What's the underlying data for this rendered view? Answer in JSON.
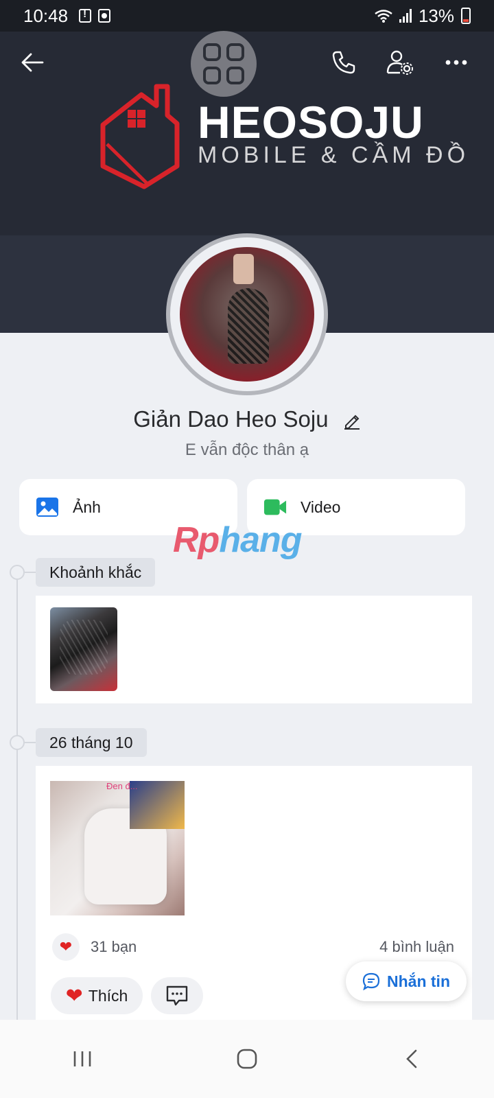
{
  "status_bar": {
    "time": "10:48",
    "battery": "13%"
  },
  "cover": {
    "brand_name": "HEOSOJU",
    "brand_tagline": "MOBILE & CẦM ĐỒ"
  },
  "profile": {
    "name": "Giản Dao Heo Soju",
    "bio": "E vẫn độc thân ạ"
  },
  "media_tabs": {
    "photos_label": "Ảnh",
    "video_label": "Video"
  },
  "watermark": {
    "part1": "Rp",
    "part2": "hang"
  },
  "timeline": [
    {
      "label": "Khoảnh khắc"
    },
    {
      "label": "26 tháng 10",
      "photo_caption": "Đen đ..."
    }
  ],
  "post": {
    "reaction_count": "31 bạn",
    "comment_count": "4 bình luận",
    "like_label": "Thích"
  },
  "message_button": {
    "label": "Nhắn tin"
  },
  "colors": {
    "accent_blue": "#1a6fd8",
    "like_red": "#e02424",
    "video_green": "#2dbb5d",
    "photo_blue": "#1a74e8"
  }
}
